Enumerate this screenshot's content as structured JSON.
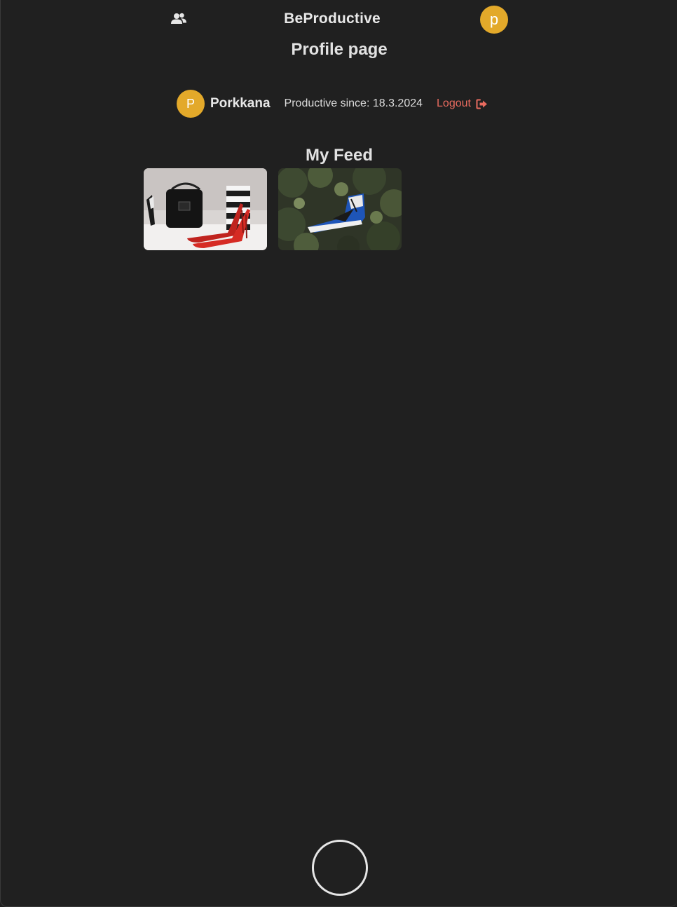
{
  "header": {
    "app_title": "BeProductive",
    "avatar_initial": "p",
    "friends_icon": "users-icon"
  },
  "page": {
    "title": "Profile page"
  },
  "profile": {
    "avatar_initial": "P",
    "username": "Porkkana",
    "since_text": "Productive since: 18.3.2024",
    "logout_label": "Logout",
    "logout_icon": "sign-out-icon"
  },
  "feed": {
    "title": "My Feed",
    "items": [
      {
        "subject": "shoes-and-bag-photo"
      },
      {
        "subject": "sneaker-in-plants-photo"
      }
    ]
  },
  "colors": {
    "background": "#202020",
    "accent": "#e3a92a",
    "logout": "#e96b5f",
    "text": "#e6e6e6"
  }
}
